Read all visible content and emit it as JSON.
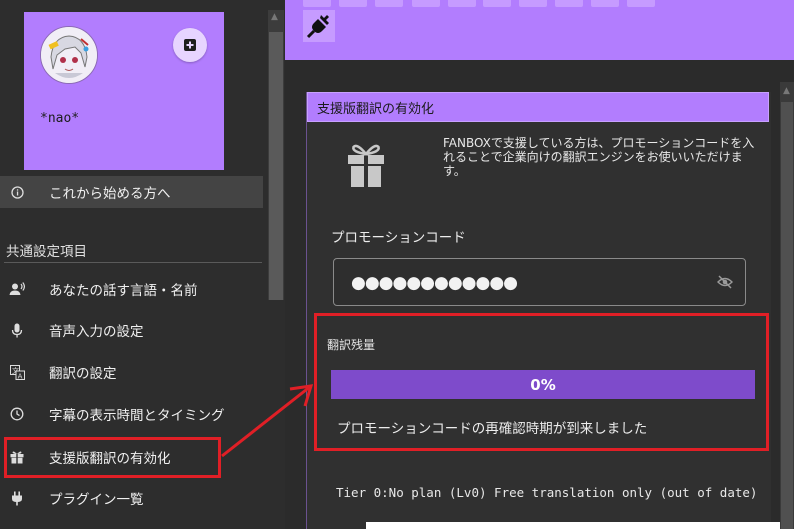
{
  "sidebar": {
    "username": "*nao*",
    "add_icon": "+",
    "getting_started": {
      "icon": "info-icon",
      "label": "これから始める方へ"
    },
    "section_title": "共通設定項目",
    "items": [
      {
        "icon": "voice-person-icon",
        "label": "あなたの話す言語・名前"
      },
      {
        "icon": "mic-icon",
        "label": "音声入力の設定"
      },
      {
        "icon": "translate-icon",
        "label": "翻訳の設定"
      },
      {
        "icon": "clock-icon",
        "label": "字幕の表示時間とタイミング"
      },
      {
        "icon": "gift-icon",
        "label": "支援版翻訳の有効化"
      },
      {
        "icon": "plug-icon",
        "label": "プラグイン一覧"
      }
    ]
  },
  "toolbar": {
    "plugin_icon": "plug-icon"
  },
  "panel": {
    "header": "支援版翻訳の有効化",
    "gift_icon": "gift-icon",
    "description": "FANBOXで支援している方は、プロモーションコードを入れることで企業向けの翻訳エンジンをお使いいただけます。",
    "code_label": "プロモーションコード",
    "code_value": "●●●●●●●●●●●●",
    "visibility_icon": "eye-off-icon",
    "remaining_label": "翻訳残量",
    "progress_fraction": 0,
    "progress_text": "0%",
    "renew_message": "プロモーションコードの再確認時期が到来しました",
    "tier_text": "Tier 0:No plan (Lv0) Free translation only (out of date)"
  },
  "colors": {
    "accent": "#b27dfe",
    "progress": "#7e4bcb",
    "annotation": "#e01f26"
  }
}
